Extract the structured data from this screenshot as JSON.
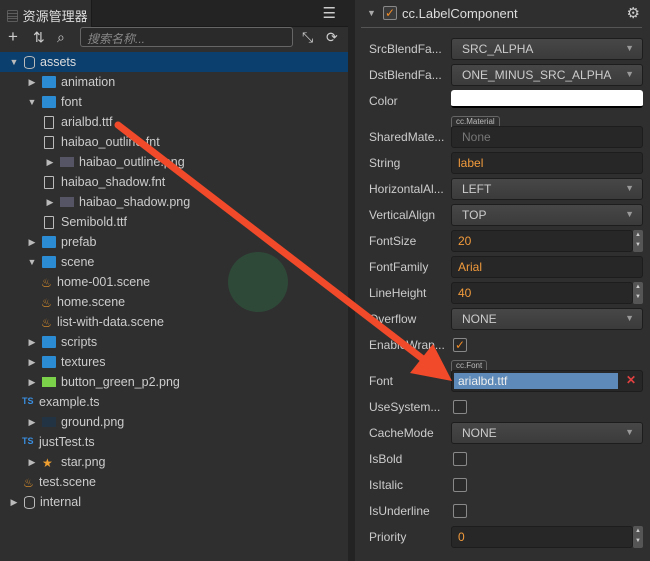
{
  "assets_panel": {
    "tab_title": "资源管理器",
    "search_placeholder": "搜索名称...",
    "tree": [
      {
        "label": "assets",
        "icon": "database",
        "depth": 0,
        "arrow": "open",
        "selected": true
      },
      {
        "label": "animation",
        "icon": "folder",
        "depth": 1,
        "arrow": "closed"
      },
      {
        "label": "font",
        "icon": "folder",
        "depth": 1,
        "arrow": "open"
      },
      {
        "label": "arialbd.ttf",
        "icon": "file",
        "depth": 2,
        "arrow": ""
      },
      {
        "label": "haibao_outline.fnt",
        "icon": "file",
        "depth": 2,
        "arrow": ""
      },
      {
        "label": "haibao_outline.png",
        "icon": "image",
        "depth": 3,
        "arrow": "closed"
      },
      {
        "label": "haibao_shadow.fnt",
        "icon": "file",
        "depth": 2,
        "arrow": ""
      },
      {
        "label": "haibao_shadow.png",
        "icon": "image",
        "depth": 3,
        "arrow": "closed"
      },
      {
        "label": "Semibold.ttf",
        "icon": "file",
        "depth": 2,
        "arrow": ""
      },
      {
        "label": "prefab",
        "icon": "folder",
        "depth": 1,
        "arrow": "closed"
      },
      {
        "label": "scene",
        "icon": "folder",
        "depth": 1,
        "arrow": "open"
      },
      {
        "label": "home-001.scene",
        "icon": "scene",
        "depth": 2,
        "arrow": ""
      },
      {
        "label": "home.scene",
        "icon": "scene",
        "depth": 2,
        "arrow": ""
      },
      {
        "label": "list-with-data.scene",
        "icon": "scene",
        "depth": 2,
        "arrow": ""
      },
      {
        "label": "scripts",
        "icon": "folder",
        "depth": 1,
        "arrow": "closed"
      },
      {
        "label": "textures",
        "icon": "folder",
        "depth": 1,
        "arrow": "closed"
      },
      {
        "label": "button_green_p2.png",
        "icon": "image-green",
        "depth": 1,
        "arrow": "closed"
      },
      {
        "label": "example.ts",
        "icon": "ts",
        "depth": 1,
        "arrow": ""
      },
      {
        "label": "ground.png",
        "icon": "image-dark",
        "depth": 1,
        "arrow": "closed"
      },
      {
        "label": "justTest.ts",
        "icon": "ts",
        "depth": 1,
        "arrow": ""
      },
      {
        "label": "star.png",
        "icon": "star",
        "depth": 1,
        "arrow": "closed"
      },
      {
        "label": "test.scene",
        "icon": "scene",
        "depth": 1,
        "arrow": ""
      },
      {
        "label": "internal",
        "icon": "database",
        "depth": 0,
        "arrow": "closed"
      }
    ]
  },
  "inspector": {
    "component_name": "cc.LabelComponent",
    "component_enabled": true,
    "props": {
      "src_blend": {
        "label": "SrcBlendFa...",
        "value": "SRC_ALPHA"
      },
      "dst_blend": {
        "label": "DstBlendFa...",
        "value": "ONE_MINUS_SRC_ALPHA"
      },
      "color": {
        "label": "Color",
        "value": "#ffffff"
      },
      "shared_material": {
        "label": "SharedMate...",
        "type": "cc.Material",
        "value": "None"
      },
      "string": {
        "label": "String",
        "value": "label"
      },
      "h_align": {
        "label": "HorizontalAl...",
        "value": "LEFT"
      },
      "v_align": {
        "label": "VerticalAlign",
        "value": "TOP"
      },
      "font_size": {
        "label": "FontSize",
        "value": "20"
      },
      "font_family": {
        "label": "FontFamily",
        "value": "Arial"
      },
      "line_height": {
        "label": "LineHeight",
        "value": "40"
      },
      "overflow": {
        "label": "Overflow",
        "value": "NONE"
      },
      "enable_wrap": {
        "label": "EnableWrap...",
        "checked": true
      },
      "font": {
        "label": "Font",
        "type": "cc.Font",
        "value": "arialbd.ttf"
      },
      "use_system_font": {
        "label": "UseSystem...",
        "checked": false
      },
      "cache_mode": {
        "label": "CacheMode",
        "value": "NONE"
      },
      "is_bold": {
        "label": "IsBold",
        "checked": false
      },
      "is_italic": {
        "label": "IsItalic",
        "checked": false
      },
      "is_underline": {
        "label": "IsUnderline",
        "checked": false
      },
      "priority": {
        "label": "Priority",
        "value": "0"
      }
    }
  },
  "annotation_color": "#f04a2a"
}
